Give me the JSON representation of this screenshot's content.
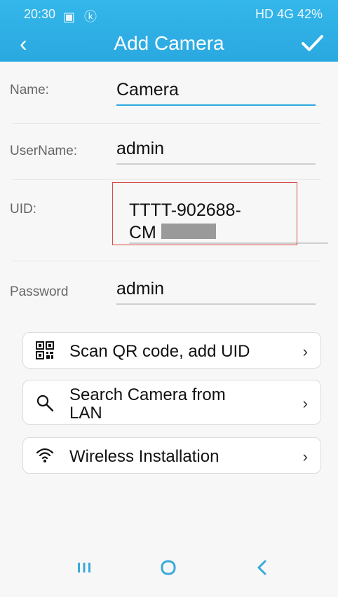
{
  "status": {
    "time": "20:30",
    "left_icons": "▣ ⓚ",
    "right": "HD 4G 42%"
  },
  "header": {
    "title": "Add Camera",
    "back_symbol": "‹",
    "confirm_symbol": "✓"
  },
  "form": {
    "name": {
      "label": "Name:",
      "value": "Camera"
    },
    "username": {
      "label": "UserName:",
      "value": "admin"
    },
    "uid": {
      "label": "UID:",
      "value_line1": "TTTT-902688-",
      "value_line2": "CM"
    },
    "password": {
      "label": "Password",
      "value": "admin"
    }
  },
  "actions": [
    {
      "label": "Scan QR code, add UID",
      "icon": "qr-code-icon"
    },
    {
      "label_line1": "Search Camera from",
      "label_line2": "LAN",
      "icon": "search-icon"
    },
    {
      "label": "Wireless Installation",
      "icon": "wifi-icon"
    }
  ],
  "colors": {
    "primary": "#2aa8e0",
    "highlight_box": "#d84a4a"
  },
  "bottom_nav": [
    "recents",
    "home",
    "back"
  ]
}
